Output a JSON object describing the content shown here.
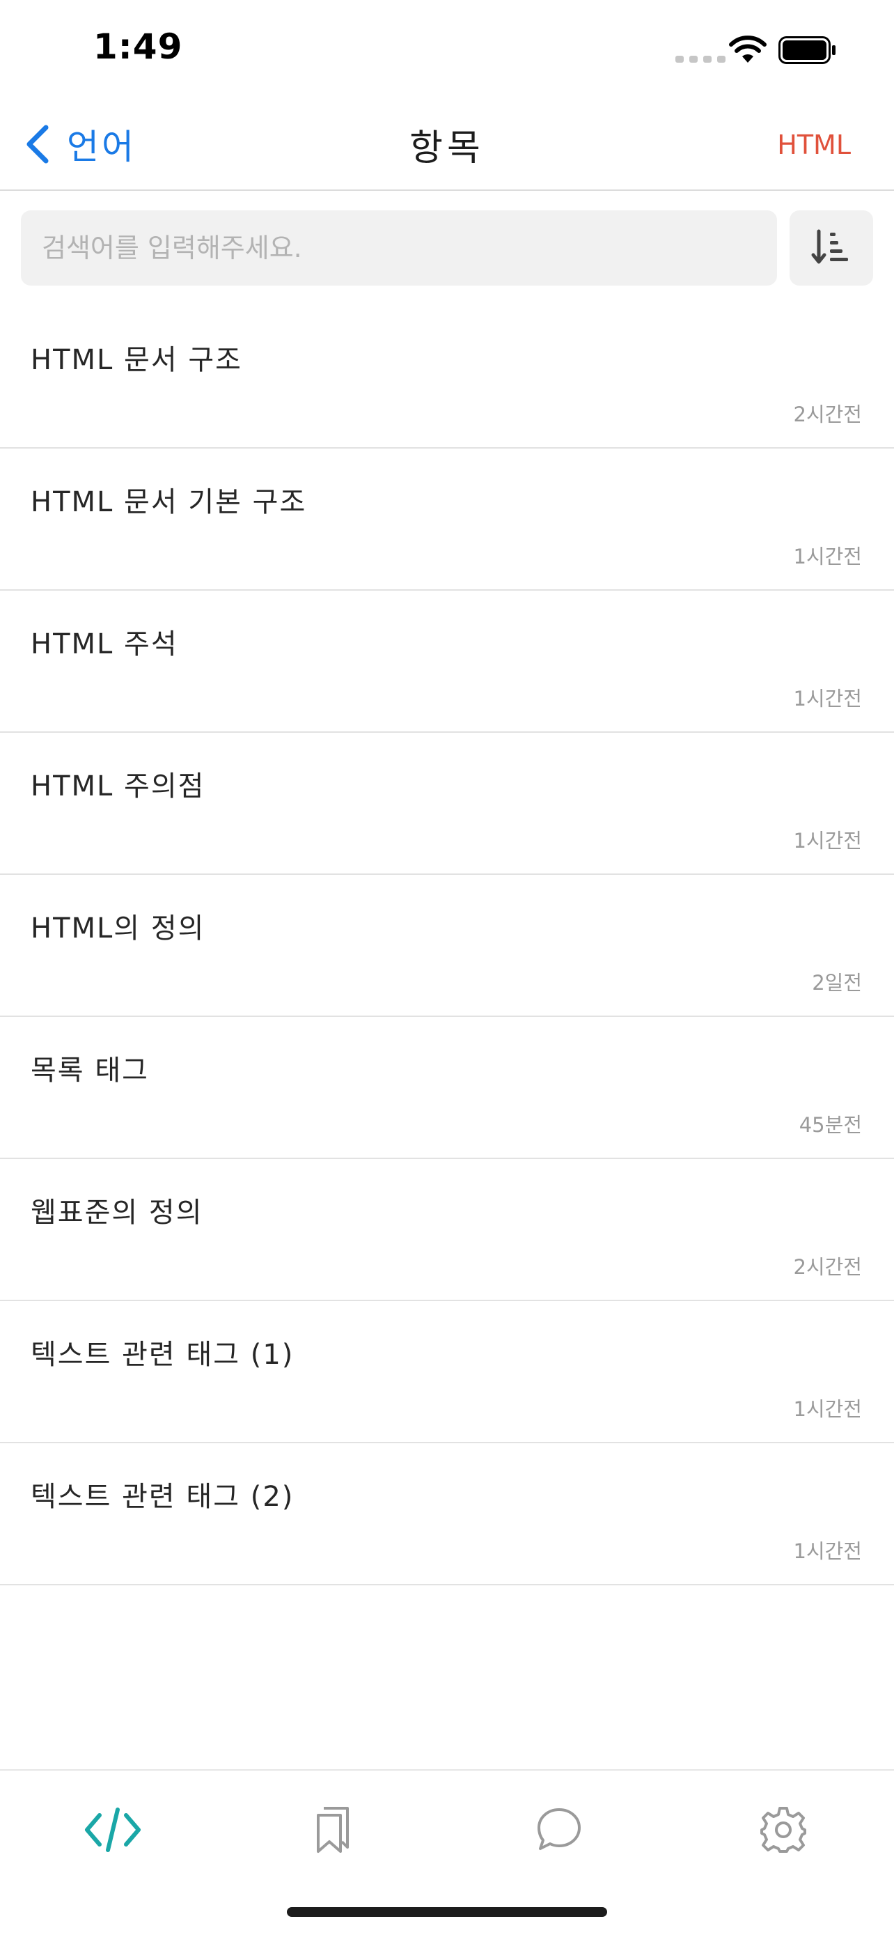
{
  "status_bar": {
    "time": "1:49"
  },
  "nav": {
    "back_label": "언어",
    "title": "항목",
    "right_label": "HTML"
  },
  "search": {
    "placeholder": "검색어를 입력해주세요.",
    "value": ""
  },
  "items": [
    {
      "title": "HTML 문서 구조",
      "time": "2시간전"
    },
    {
      "title": "HTML 문서 기본 구조",
      "time": "1시간전"
    },
    {
      "title": "HTML 주석",
      "time": "1시간전"
    },
    {
      "title": "HTML 주의점",
      "time": "1시간전"
    },
    {
      "title": "HTML의 정의",
      "time": "2일전"
    },
    {
      "title": "목록 태그",
      "time": "45분전"
    },
    {
      "title": "웹표준의 정의",
      "time": "2시간전"
    },
    {
      "title": "텍스트 관련 태그 (1)",
      "time": "1시간전"
    },
    {
      "title": "텍스트 관련 태그 (2)",
      "time": "1시간전"
    }
  ],
  "tabs": [
    {
      "icon": "code-icon",
      "active": true
    },
    {
      "icon": "bookmark-icon",
      "active": false
    },
    {
      "icon": "chat-icon",
      "active": false
    },
    {
      "icon": "gear-icon",
      "active": false
    }
  ],
  "colors": {
    "accent": "#1a7ae6",
    "right_label": "#e0513b",
    "tab_active": "#1aa7a7",
    "tab_inactive": "#9a9a9a"
  }
}
